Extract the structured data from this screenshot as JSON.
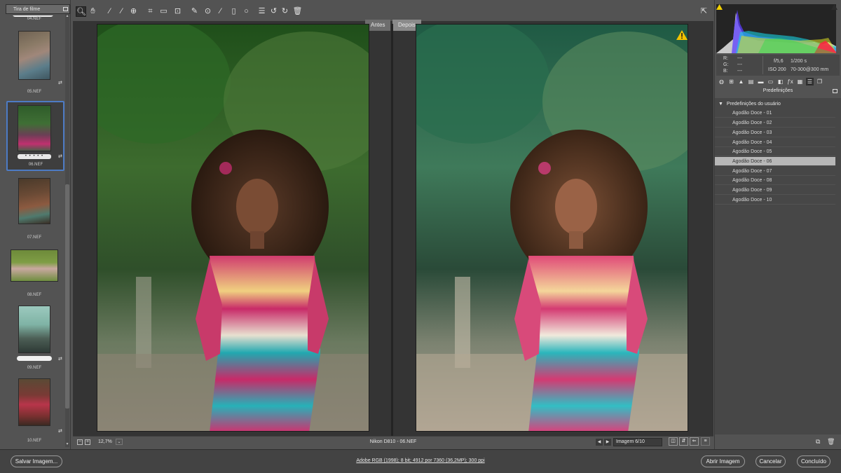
{
  "filmstrip": {
    "header": "Tira de filme",
    "items": [
      {
        "name": "04.NEF"
      },
      {
        "name": "05.NEF"
      },
      {
        "name": "06.NEF"
      },
      {
        "name": "07.NEF"
      },
      {
        "name": "08.NEF"
      },
      {
        "name": "09.NEF"
      },
      {
        "name": "10.NEF"
      }
    ],
    "selected_index": 2
  },
  "toolbar": {
    "tools": [
      "zoom-icon",
      "hand-icon",
      "white-balance-icon",
      "color-sampler-icon",
      "target-adjust-icon",
      "crop-icon",
      "straighten-icon",
      "transform-icon",
      "spot-removal-icon",
      "red-eye-icon",
      "adjustment-brush-icon",
      "graduated-filter-icon",
      "radial-filter-icon",
      "preferences-icon",
      "rotate-left-icon",
      "rotate-right-icon",
      "trash-icon"
    ],
    "active_tool": "zoom-icon"
  },
  "preview": {
    "before_label": "Antes",
    "after_label": "Depois"
  },
  "previewbar": {
    "zoom": "12,7%",
    "file_info": "Nikon D810  -  06.NEF",
    "image_counter": "Imagem 6/10"
  },
  "readout": {
    "r_label": "R:",
    "g_label": "G:",
    "b_label": "B:",
    "r_value": "---",
    "g_value": "---",
    "b_value": "---",
    "aperture": "f/5,6",
    "shutter": "1/200 s",
    "iso": "ISO 200",
    "lens": "70-300@300 mm"
  },
  "panel": {
    "title": "Predefinições",
    "group": "Predefinições do usuário",
    "presets": [
      {
        "label": "Agodão Doce - 01"
      },
      {
        "label": "Agodão Doce - 02"
      },
      {
        "label": "Agodão Doce - 03"
      },
      {
        "label": "Agodão Doce - 04"
      },
      {
        "label": "Agodão Doce - 05"
      },
      {
        "label": "Agodão Doce - 06"
      },
      {
        "label": "Agodão Doce - 07"
      },
      {
        "label": "Agodão Doce - 08"
      },
      {
        "label": "Agodão Doce - 09"
      },
      {
        "label": "Agodão Doce - 10"
      }
    ],
    "selected_index": 5
  },
  "footer": {
    "save_label": "Salvar Imagem...",
    "workflow": "Adobe RGB (1998); 8 bit; 4912 por 7360 (36,2MP); 300 ppi",
    "open_label": "Abrir Imagem",
    "cancel_label": "Cancelar",
    "done_label": "Concluído"
  },
  "colors": {
    "accent": "#4d7bc4",
    "selected_preset": "#b7b7b7",
    "warning": "#f2c200"
  }
}
